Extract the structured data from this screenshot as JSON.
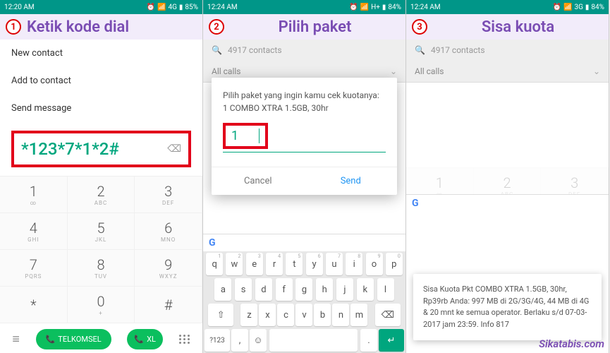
{
  "panel1": {
    "status": {
      "time": "12:20 AM",
      "net": "4G",
      "battery": "85%"
    },
    "step": "1",
    "title": "Ketik kode dial",
    "menu": [
      "New contact",
      "Add to contact",
      "Send message"
    ],
    "dial_code": "*123*7*1*2#",
    "keys": [
      {
        "n": "1",
        "s": "∞"
      },
      {
        "n": "2",
        "s": "ABC"
      },
      {
        "n": "3",
        "s": "DEF"
      },
      {
        "n": "4",
        "s": "GHI"
      },
      {
        "n": "5",
        "s": "JKL"
      },
      {
        "n": "6",
        "s": "MNO"
      },
      {
        "n": "7",
        "s": "PQRS"
      },
      {
        "n": "8",
        "s": "TUV"
      },
      {
        "n": "9",
        "s": "WXYZ"
      },
      {
        "n": "*",
        "s": ""
      },
      {
        "n": "0",
        "s": "+"
      },
      {
        "n": "#",
        "s": ""
      }
    ],
    "call1": "TELKOMSEL",
    "call2": "XL"
  },
  "panel2": {
    "status": {
      "time": "12:24 AM",
      "net": "H+",
      "battery": "84%"
    },
    "step": "2",
    "title": "Pilih paket",
    "search": "4917 contacts",
    "filter": "All calls",
    "dialog_msg": "Pilih paket yang ingin kamu cek kuotanya:\n1 COMBO XTRA 1.5GB, 30hr",
    "input": "1",
    "cancel": "Cancel",
    "send": "Send",
    "kb_r1": [
      [
        "q",
        "1"
      ],
      [
        "w",
        "2"
      ],
      [
        "e",
        "3"
      ],
      [
        "r",
        "4"
      ],
      [
        "t",
        "5"
      ],
      [
        "y",
        "6"
      ],
      [
        "u",
        "7"
      ],
      [
        "i",
        "8"
      ],
      [
        "o",
        "9"
      ],
      [
        "p",
        "0"
      ]
    ],
    "kb_r2": [
      "a",
      "s",
      "d",
      "f",
      "g",
      "h",
      "j",
      "k",
      "l"
    ],
    "kb_r3": [
      "z",
      "x",
      "c",
      "v",
      "b",
      "n",
      "m"
    ],
    "sym": "?123"
  },
  "panel3": {
    "status": {
      "time": "12:24 AM",
      "net": "3G",
      "battery": "84%"
    },
    "step": "3",
    "title": "Sisa kuota",
    "search": "4917 contacts",
    "filter": "All calls",
    "keys": [
      {
        "n": "1",
        "s": "∞"
      },
      {
        "n": "2",
        "s": "ABC"
      },
      {
        "n": "3",
        "s": "DEF"
      }
    ],
    "toast": "Sisa Kuota Pkt  COMBO XTRA 1.5GB, 30hr, Rp39rb Anda: 997 MB di 2G/3G/4G,  44 MB di 4G & 20 mnt  ke semua operator. Berlaku s/d 07-03-2017 jam 23:59. Info 817",
    "watermark": "Sikatabis.com"
  }
}
